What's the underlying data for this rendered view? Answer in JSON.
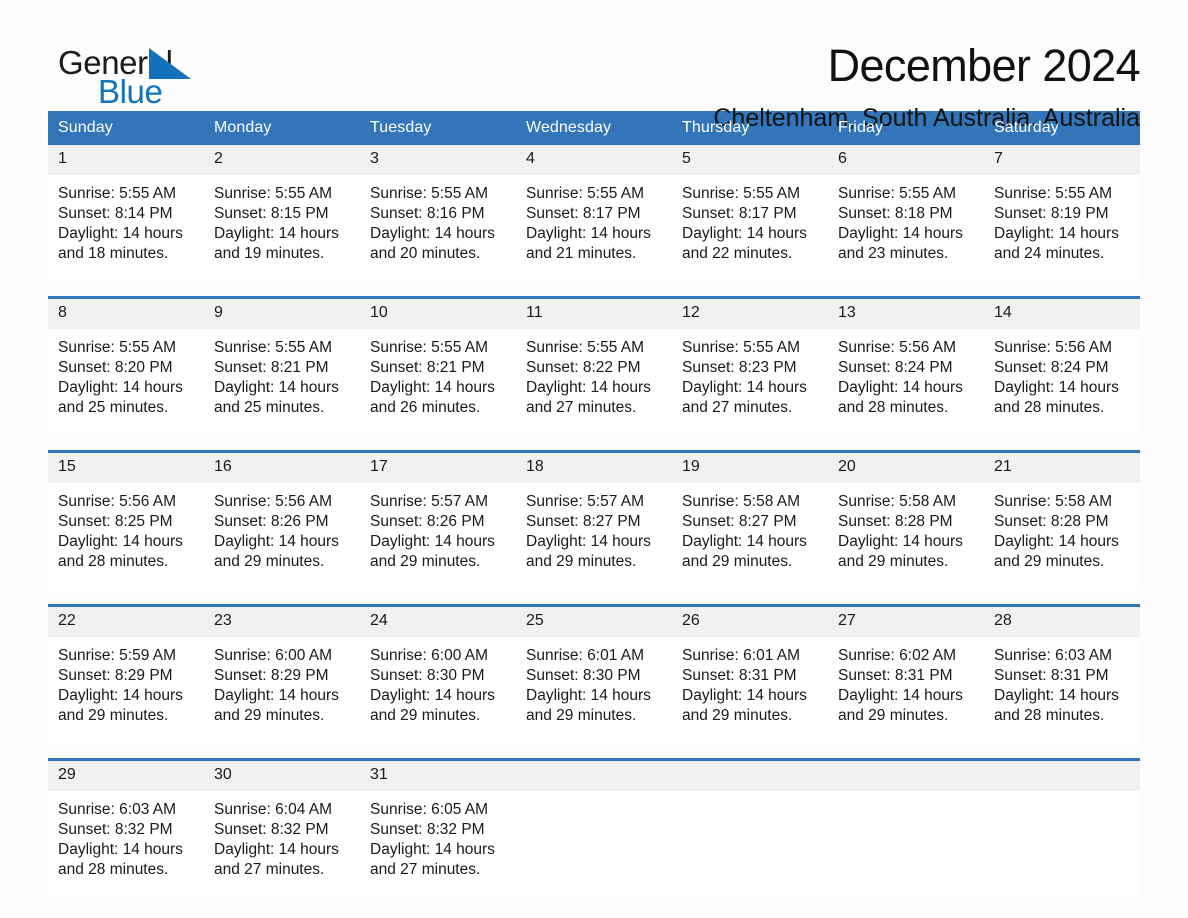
{
  "brand": {
    "word_one": "General",
    "word_two": "Blue",
    "triangle_color": "#1272bb"
  },
  "header": {
    "title": "December 2024",
    "location": "Cheltenham, South Australia, Australia",
    "accent_color": "#3275b8",
    "daynum_band_color": "#f1f1f1"
  },
  "calendar": {
    "weekday_headers": [
      "Sunday",
      "Monday",
      "Tuesday",
      "Wednesday",
      "Thursday",
      "Friday",
      "Saturday"
    ],
    "labels": {
      "sunrise_prefix": "Sunrise:",
      "sunset_prefix": "Sunset:",
      "daylight_prefix": "Daylight:"
    },
    "weeks": [
      [
        {
          "day": "1",
          "sunrise": "Sunrise: 5:55 AM",
          "sunset": "Sunset: 8:14 PM",
          "daylight": "Daylight: 14 hours and 18 minutes."
        },
        {
          "day": "2",
          "sunrise": "Sunrise: 5:55 AM",
          "sunset": "Sunset: 8:15 PM",
          "daylight": "Daylight: 14 hours and 19 minutes."
        },
        {
          "day": "3",
          "sunrise": "Sunrise: 5:55 AM",
          "sunset": "Sunset: 8:16 PM",
          "daylight": "Daylight: 14 hours and 20 minutes."
        },
        {
          "day": "4",
          "sunrise": "Sunrise: 5:55 AM",
          "sunset": "Sunset: 8:17 PM",
          "daylight": "Daylight: 14 hours and 21 minutes."
        },
        {
          "day": "5",
          "sunrise": "Sunrise: 5:55 AM",
          "sunset": "Sunset: 8:17 PM",
          "daylight": "Daylight: 14 hours and 22 minutes."
        },
        {
          "day": "6",
          "sunrise": "Sunrise: 5:55 AM",
          "sunset": "Sunset: 8:18 PM",
          "daylight": "Daylight: 14 hours and 23 minutes."
        },
        {
          "day": "7",
          "sunrise": "Sunrise: 5:55 AM",
          "sunset": "Sunset: 8:19 PM",
          "daylight": "Daylight: 14 hours and 24 minutes."
        }
      ],
      [
        {
          "day": "8",
          "sunrise": "Sunrise: 5:55 AM",
          "sunset": "Sunset: 8:20 PM",
          "daylight": "Daylight: 14 hours and 25 minutes."
        },
        {
          "day": "9",
          "sunrise": "Sunrise: 5:55 AM",
          "sunset": "Sunset: 8:21 PM",
          "daylight": "Daylight: 14 hours and 25 minutes."
        },
        {
          "day": "10",
          "sunrise": "Sunrise: 5:55 AM",
          "sunset": "Sunset: 8:21 PM",
          "daylight": "Daylight: 14 hours and 26 minutes."
        },
        {
          "day": "11",
          "sunrise": "Sunrise: 5:55 AM",
          "sunset": "Sunset: 8:22 PM",
          "daylight": "Daylight: 14 hours and 27 minutes."
        },
        {
          "day": "12",
          "sunrise": "Sunrise: 5:55 AM",
          "sunset": "Sunset: 8:23 PM",
          "daylight": "Daylight: 14 hours and 27 minutes."
        },
        {
          "day": "13",
          "sunrise": "Sunrise: 5:56 AM",
          "sunset": "Sunset: 8:24 PM",
          "daylight": "Daylight: 14 hours and 28 minutes."
        },
        {
          "day": "14",
          "sunrise": "Sunrise: 5:56 AM",
          "sunset": "Sunset: 8:24 PM",
          "daylight": "Daylight: 14 hours and 28 minutes."
        }
      ],
      [
        {
          "day": "15",
          "sunrise": "Sunrise: 5:56 AM",
          "sunset": "Sunset: 8:25 PM",
          "daylight": "Daylight: 14 hours and 28 minutes."
        },
        {
          "day": "16",
          "sunrise": "Sunrise: 5:56 AM",
          "sunset": "Sunset: 8:26 PM",
          "daylight": "Daylight: 14 hours and 29 minutes."
        },
        {
          "day": "17",
          "sunrise": "Sunrise: 5:57 AM",
          "sunset": "Sunset: 8:26 PM",
          "daylight": "Daylight: 14 hours and 29 minutes."
        },
        {
          "day": "18",
          "sunrise": "Sunrise: 5:57 AM",
          "sunset": "Sunset: 8:27 PM",
          "daylight": "Daylight: 14 hours and 29 minutes."
        },
        {
          "day": "19",
          "sunrise": "Sunrise: 5:58 AM",
          "sunset": "Sunset: 8:27 PM",
          "daylight": "Daylight: 14 hours and 29 minutes."
        },
        {
          "day": "20",
          "sunrise": "Sunrise: 5:58 AM",
          "sunset": "Sunset: 8:28 PM",
          "daylight": "Daylight: 14 hours and 29 minutes."
        },
        {
          "day": "21",
          "sunrise": "Sunrise: 5:58 AM",
          "sunset": "Sunset: 8:28 PM",
          "daylight": "Daylight: 14 hours and 29 minutes."
        }
      ],
      [
        {
          "day": "22",
          "sunrise": "Sunrise: 5:59 AM",
          "sunset": "Sunset: 8:29 PM",
          "daylight": "Daylight: 14 hours and 29 minutes."
        },
        {
          "day": "23",
          "sunrise": "Sunrise: 6:00 AM",
          "sunset": "Sunset: 8:29 PM",
          "daylight": "Daylight: 14 hours and 29 minutes."
        },
        {
          "day": "24",
          "sunrise": "Sunrise: 6:00 AM",
          "sunset": "Sunset: 8:30 PM",
          "daylight": "Daylight: 14 hours and 29 minutes."
        },
        {
          "day": "25",
          "sunrise": "Sunrise: 6:01 AM",
          "sunset": "Sunset: 8:30 PM",
          "daylight": "Daylight: 14 hours and 29 minutes."
        },
        {
          "day": "26",
          "sunrise": "Sunrise: 6:01 AM",
          "sunset": "Sunset: 8:31 PM",
          "daylight": "Daylight: 14 hours and 29 minutes."
        },
        {
          "day": "27",
          "sunrise": "Sunrise: 6:02 AM",
          "sunset": "Sunset: 8:31 PM",
          "daylight": "Daylight: 14 hours and 29 minutes."
        },
        {
          "day": "28",
          "sunrise": "Sunrise: 6:03 AM",
          "sunset": "Sunset: 8:31 PM",
          "daylight": "Daylight: 14 hours and 28 minutes."
        }
      ],
      [
        {
          "day": "29",
          "sunrise": "Sunrise: 6:03 AM",
          "sunset": "Sunset: 8:32 PM",
          "daylight": "Daylight: 14 hours and 28 minutes."
        },
        {
          "day": "30",
          "sunrise": "Sunrise: 6:04 AM",
          "sunset": "Sunset: 8:32 PM",
          "daylight": "Daylight: 14 hours and 27 minutes."
        },
        {
          "day": "31",
          "sunrise": "Sunrise: 6:05 AM",
          "sunset": "Sunset: 8:32 PM",
          "daylight": "Daylight: 14 hours and 27 minutes."
        },
        {
          "day": "",
          "sunrise": "",
          "sunset": "",
          "daylight": ""
        },
        {
          "day": "",
          "sunrise": "",
          "sunset": "",
          "daylight": ""
        },
        {
          "day": "",
          "sunrise": "",
          "sunset": "",
          "daylight": ""
        },
        {
          "day": "",
          "sunrise": "",
          "sunset": "",
          "daylight": ""
        }
      ]
    ]
  }
}
